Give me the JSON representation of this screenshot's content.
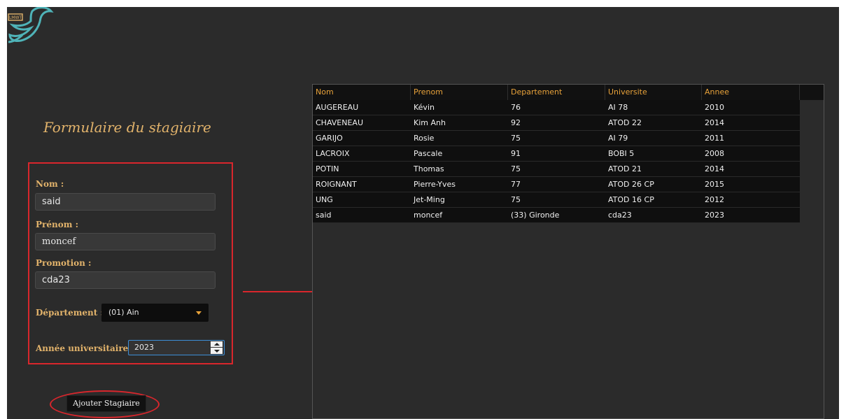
{
  "logo": {
    "text": "LMWT"
  },
  "form": {
    "title": "Formulaire du stagiaire",
    "nom_label": "Nom :",
    "nom_value": "said",
    "prenom_label": "Prénom :",
    "prenom_value": "moncef",
    "promotion_label": "Promotion :",
    "promotion_value": "cda23",
    "departement_label": "Département :",
    "departement_value": "(01) Ain",
    "annee_label": "Année universitaire :",
    "annee_value": "2023",
    "submit_label": "Ajouter Stagiaire"
  },
  "table": {
    "columns": [
      "Nom",
      "Prenom",
      "Departement",
      "Universite",
      "Annee"
    ],
    "rows": [
      [
        "AUGEREAU",
        "Kévin",
        "76",
        "AI 78",
        "2010"
      ],
      [
        "CHAVENEAU",
        "Kim Anh",
        "92",
        "ATOD 22",
        "2014"
      ],
      [
        "GARIJO",
        "Rosie",
        "75",
        "AI 79",
        "2011"
      ],
      [
        "LACROIX",
        "Pascale",
        "91",
        "BOBI 5",
        "2008"
      ],
      [
        "POTIN",
        "Thomas",
        "75",
        "ATOD 21",
        "2014"
      ],
      [
        "ROIGNANT",
        "Pierre-Yves",
        "77",
        "ATOD 26 CP",
        "2015"
      ],
      [
        "UNG",
        "Jet-Ming",
        "75",
        "ATOD 16 CP",
        "2012"
      ],
      [
        "said",
        "moncef",
        "(33) Gironde",
        "cda23",
        "2023"
      ]
    ]
  },
  "colors": {
    "background": "#2b2b2b",
    "accent": "#e2b36b",
    "header_text": "#e8a23a",
    "annotation_red": "#d9262c",
    "focus_blue": "#3d8fd9"
  }
}
